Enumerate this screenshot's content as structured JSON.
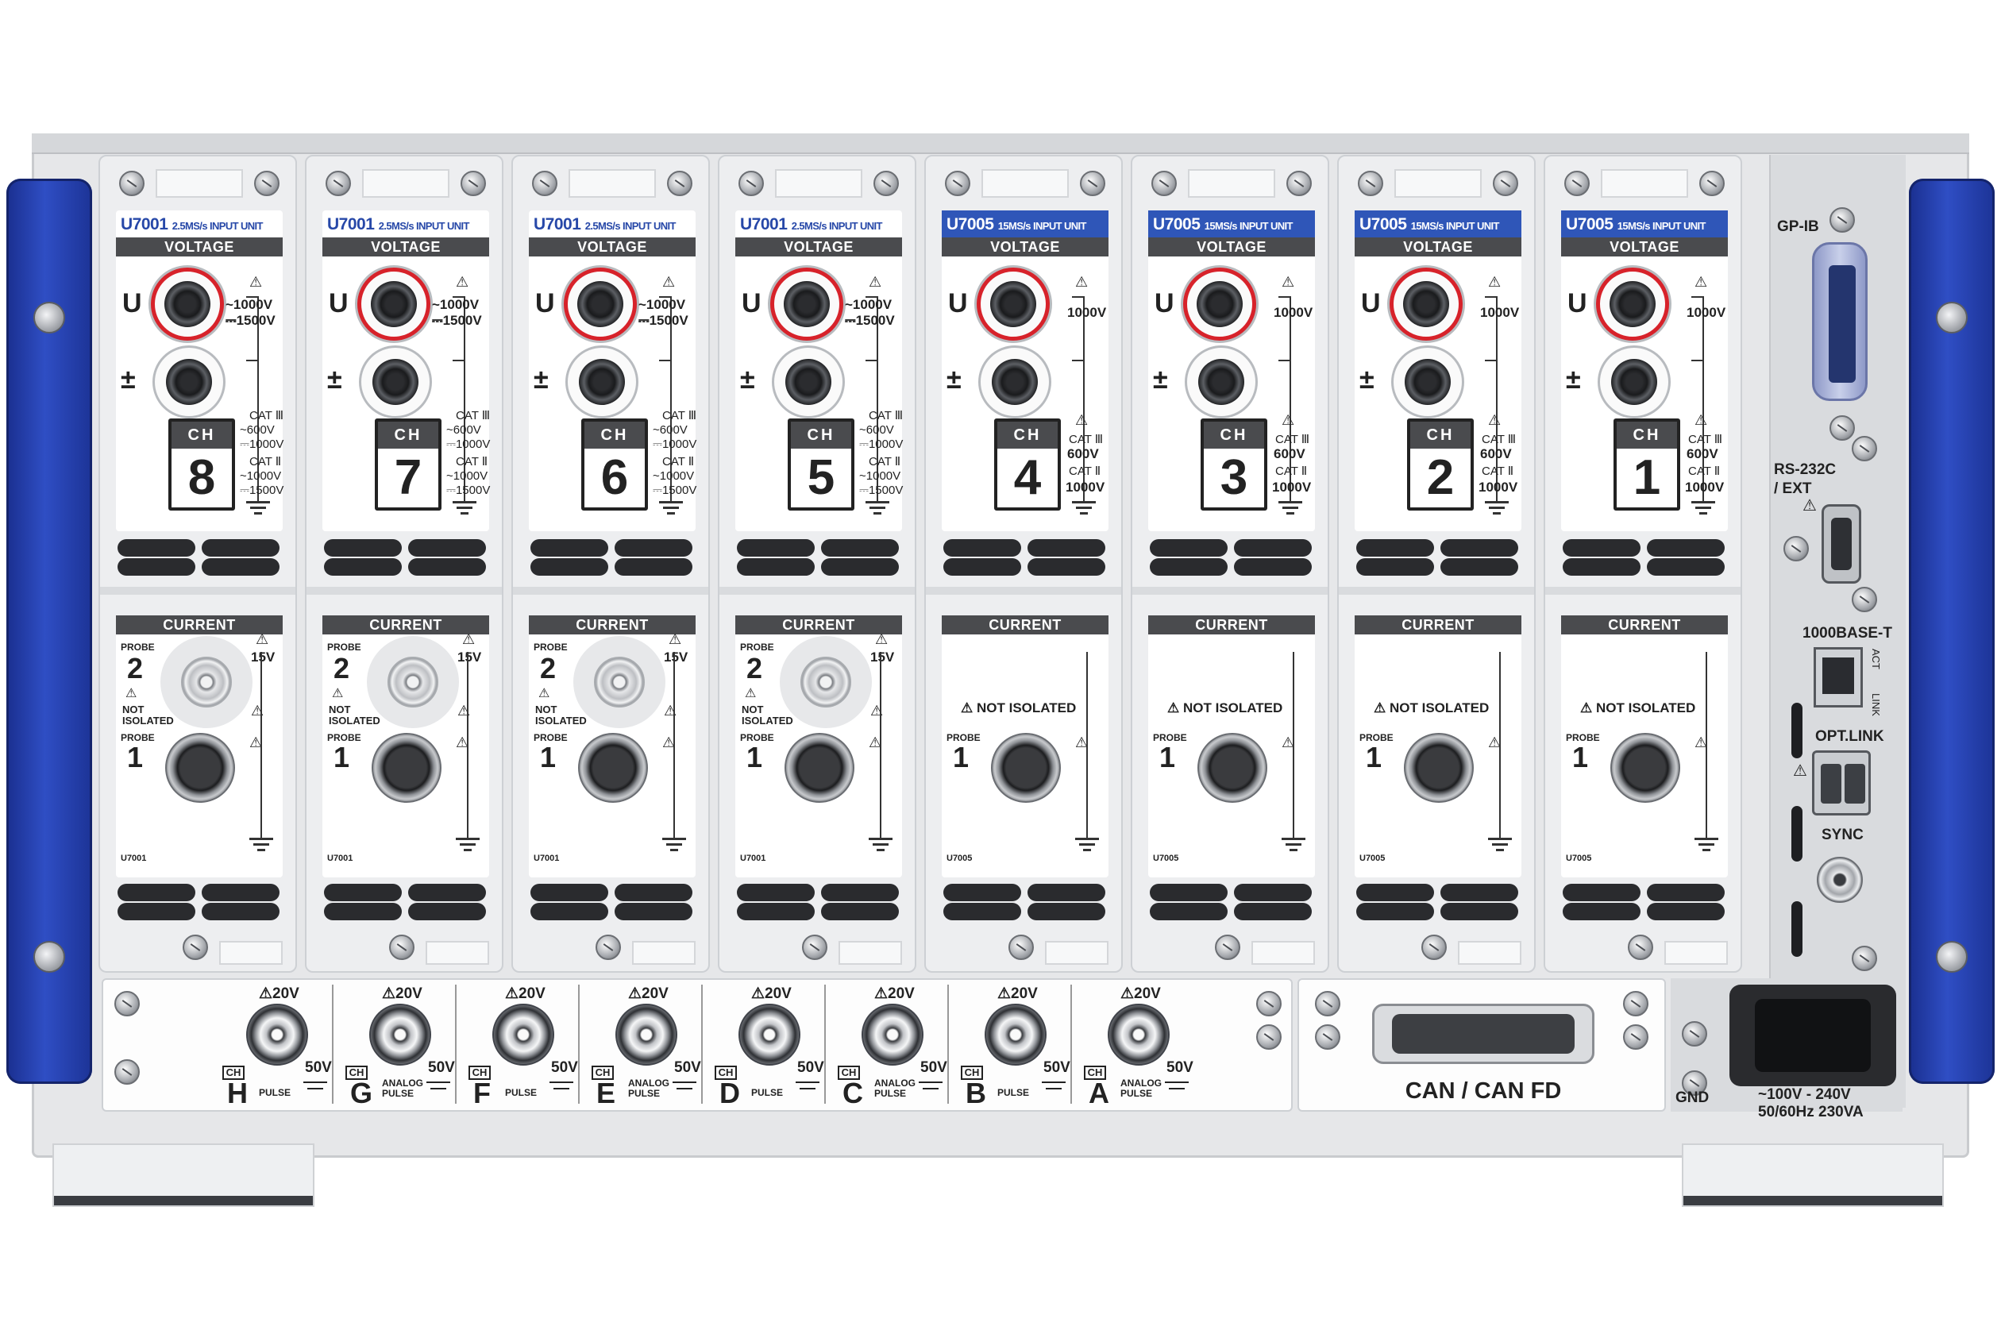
{
  "units": [
    {
      "model": "U7001",
      "rate": "2.5MS/s INPUT UNIT",
      "type": "2.5",
      "ch": "8",
      "probe_type": "U7001"
    },
    {
      "model": "U7001",
      "rate": "2.5MS/s INPUT UNIT",
      "type": "2.5",
      "ch": "7",
      "probe_type": "U7001"
    },
    {
      "model": "U7001",
      "rate": "2.5MS/s INPUT UNIT",
      "type": "2.5",
      "ch": "6",
      "probe_type": "U7001"
    },
    {
      "model": "U7001",
      "rate": "2.5MS/s INPUT UNIT",
      "type": "2.5",
      "ch": "5",
      "probe_type": "U7001"
    },
    {
      "model": "U7005",
      "rate": "15MS/s INPUT UNIT",
      "type": "15",
      "ch": "4",
      "probe_type": "U7005"
    },
    {
      "model": "U7005",
      "rate": "15MS/s INPUT UNIT",
      "type": "15",
      "ch": "3",
      "probe_type": "U7005"
    },
    {
      "model": "U7005",
      "rate": "15MS/s INPUT UNIT",
      "type": "15",
      "ch": "2",
      "probe_type": "U7005"
    },
    {
      "model": "U7005",
      "rate": "15MS/s INPUT UNIT",
      "type": "15",
      "ch": "1",
      "probe_type": "U7005"
    }
  ],
  "labels": {
    "voltage": "VOLTAGE",
    "current": "CURRENT",
    "ch": "CH",
    "u": "U",
    "pm": "±",
    "v_ac_1000": "~1000V",
    "v_dc_1500": "⎓1500V",
    "v_1000": "1000V",
    "cat3": "CAT Ⅲ",
    "cat2": "CAT Ⅱ",
    "cat3_600": "~600V",
    "cat3_1000": "⎓1000V",
    "cat2_1000": "~1000V",
    "cat2_1500": "⎓1500V",
    "v600": "600V",
    "probe": "PROBE",
    "probe2": "2",
    "probe1": "1",
    "v15": "15V",
    "not_isolated": "NOT ISOLATED",
    "not": "NOT",
    "isolated": "ISOLATED",
    "warn": "⚠"
  },
  "analog_channels": [
    {
      "letter": "H",
      "signal": "PULSE"
    },
    {
      "letter": "G",
      "signal": "ANALOG PULSE"
    },
    {
      "letter": "F",
      "signal": "PULSE"
    },
    {
      "letter": "E",
      "signal": "ANALOG PULSE"
    },
    {
      "letter": "D",
      "signal": "PULSE"
    },
    {
      "letter": "C",
      "signal": "ANALOG PULSE"
    },
    {
      "letter": "B",
      "signal": "PULSE"
    },
    {
      "letter": "A",
      "signal": "ANALOG PULSE"
    }
  ],
  "analog_labels": {
    "v20": "⚠20V",
    "v50": "50V",
    "ch": "CH"
  },
  "can_label": "CAN / CAN FD",
  "side": {
    "gpib": "GP-IB",
    "rs232": "RS-232C",
    "ext": "/ EXT",
    "eth": "1000BASE-T",
    "act": "ACT",
    "link": "LINK",
    "opt": "OPT.LINK",
    "sync": "SYNC"
  },
  "power": {
    "gnd": "GND",
    "rating1": "~100V - 240V",
    "rating2": "50/60Hz 230VA"
  },
  "colors": {
    "handle": "#2f4ec4",
    "model_blue": "#2f56b8",
    "model_text": "#2748a8",
    "jack_red": "#d7222a"
  }
}
